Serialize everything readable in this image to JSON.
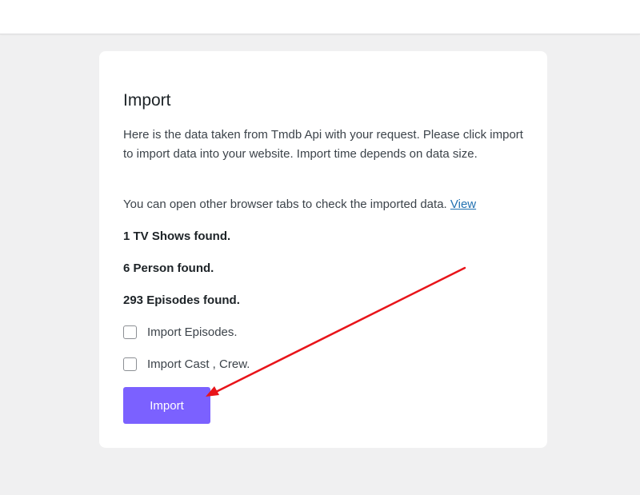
{
  "import": {
    "title": "Import",
    "description": "Here is the data taken from Tmdb Api with your request. Please click import to import data into your website. Import time depends on data size.",
    "tabs_note": "You can open other browser tabs to check the imported data.",
    "view_link": "View",
    "tv_shows_found": "1 TV Shows found.",
    "person_found": "6 Person found.",
    "episodes_found": "293 Episodes found.",
    "import_episodes_label": "Import Episodes.",
    "import_cast_label": "Import Cast , Crew.",
    "import_button": "Import"
  },
  "colors": {
    "button": "#7b61ff",
    "arrow": "#e8141a",
    "link": "#2271b1"
  }
}
